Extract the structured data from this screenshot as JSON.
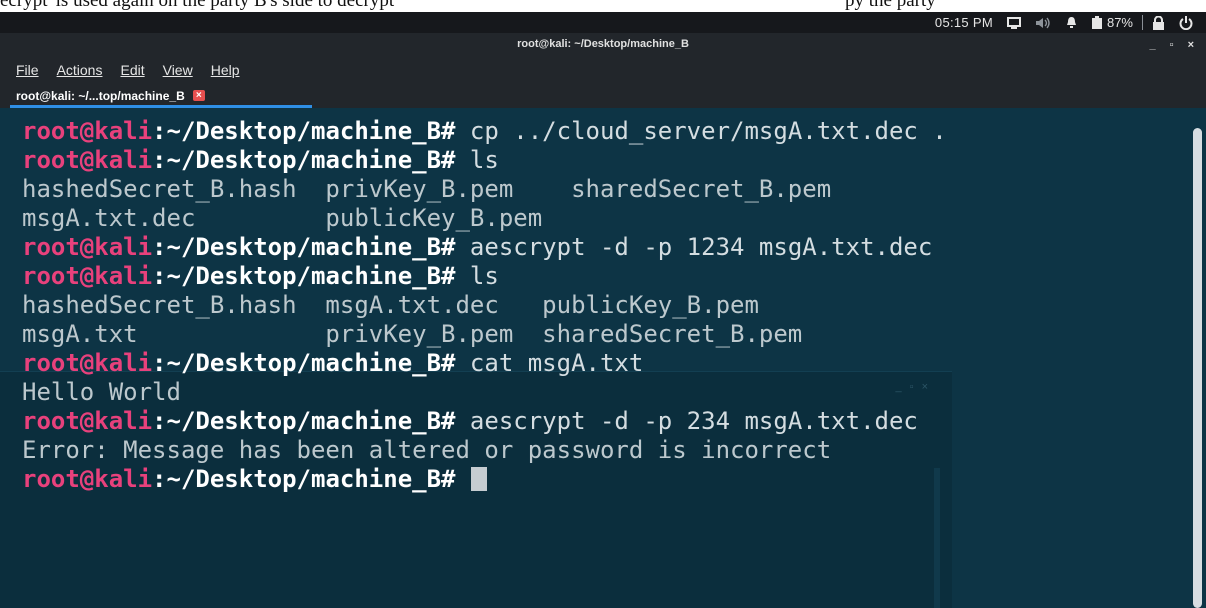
{
  "document": {
    "caption_left": "ecrypt' is used again on the party B's side to decrypt",
    "caption_right": "py the  party"
  },
  "top_panel": {
    "clock": "05:15 PM",
    "battery_percent": "87%",
    "icons": [
      "display-icon",
      "volume-icon",
      "bell-icon",
      "battery-icon",
      "lock-icon",
      "power-icon"
    ]
  },
  "window": {
    "title": "root@kali: ~/Desktop/machine_B",
    "controls": {
      "minimize": "_",
      "maximize": "▫",
      "close": "×"
    }
  },
  "menu": {
    "items": [
      {
        "label": "File"
      },
      {
        "label": "Actions"
      },
      {
        "label": "Edit"
      },
      {
        "label": "View"
      },
      {
        "label": "Help"
      }
    ]
  },
  "tab": {
    "label": "root@kali: ~/...top/machine_B",
    "close": "×"
  },
  "terminal": {
    "prompt_user": "root@kali",
    "prompt_path": "~/Desktop/machine_B",
    "lines": [
      {
        "kind": "prompt",
        "command": " cp ../cloud_server/msgA.txt.dec ."
      },
      {
        "kind": "prompt",
        "command": " ls"
      },
      {
        "kind": "output",
        "text": "hashedSecret_B.hash  privKey_B.pem    sharedSecret_B.pem"
      },
      {
        "kind": "output",
        "text": "msgA.txt.dec         publicKey_B.pem"
      },
      {
        "kind": "prompt",
        "command": " aescrypt -d -p 1234 msgA.txt.dec"
      },
      {
        "kind": "prompt",
        "command": " ls"
      },
      {
        "kind": "output",
        "text": "hashedSecret_B.hash  msgA.txt.dec   publicKey_B.pem"
      },
      {
        "kind": "output",
        "text": "msgA.txt             privKey_B.pem  sharedSecret_B.pem"
      },
      {
        "kind": "prompt",
        "command": " cat msgA.txt"
      },
      {
        "kind": "output",
        "text": "Hello World"
      },
      {
        "kind": "prompt",
        "command": " aescrypt -d -p 234 msgA.txt.dec"
      },
      {
        "kind": "output",
        "text": "Error: Message has been altered or password is incorrect"
      },
      {
        "kind": "prompt",
        "command": " ",
        "cursor": true
      }
    ]
  },
  "colors": {
    "terminal_bg": "#0d3445",
    "prompt_user": "#e8417c",
    "tab_accent": "#2f8fe6",
    "text": "#bcc8cd"
  }
}
